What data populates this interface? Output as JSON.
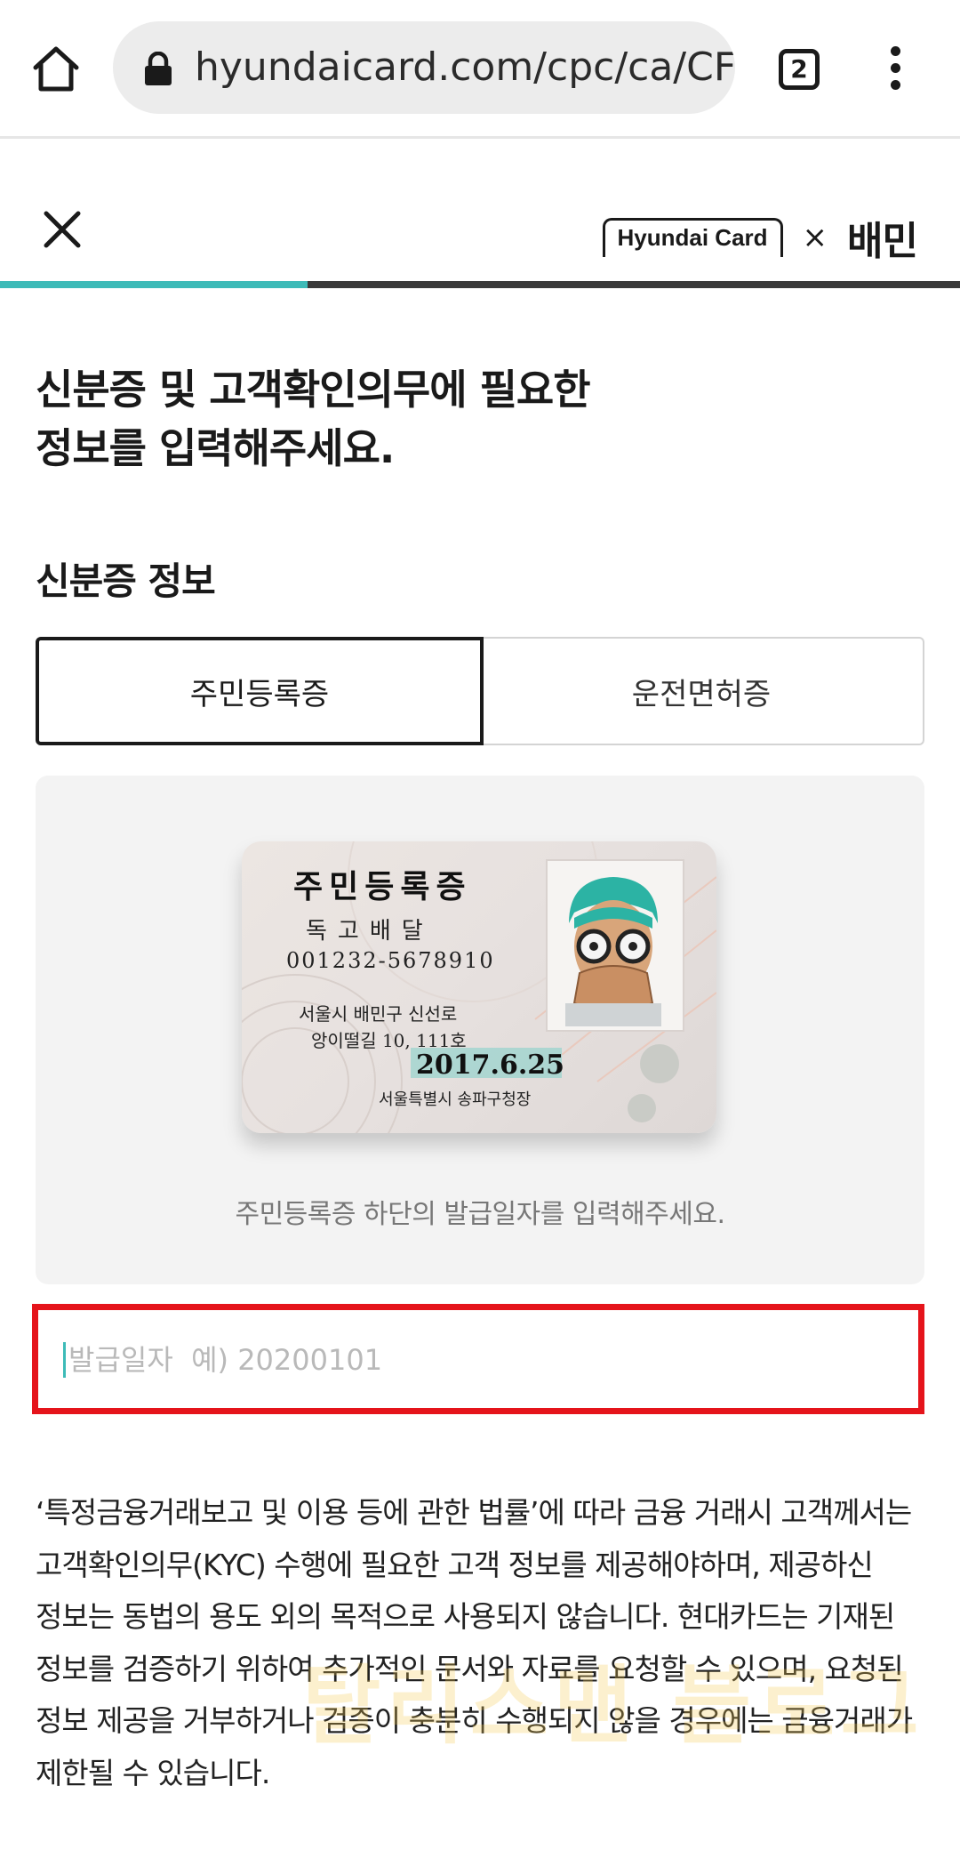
{
  "browser": {
    "url": "hyundaicard.com/cpc/ca/CF",
    "tab_count": "2",
    "icons": {
      "home": "home-icon",
      "lock": "lock-icon",
      "menu": "more-vert-icon"
    }
  },
  "header": {
    "close_icon": "close-icon",
    "brand_logo": "Hyundai Card",
    "brand_separator": "×",
    "partner_logo": "배민",
    "progress": 0.32,
    "progress_color": "#3dbbb8"
  },
  "page": {
    "title_line1": "신분증 및 고객확인의무에 필요한",
    "title_line2": "정보를 입력해주세요."
  },
  "id_section": {
    "title": "신분증 정보",
    "tabs": [
      {
        "label": "주민등록증",
        "selected": true
      },
      {
        "label": "운전면허증",
        "selected": false
      }
    ],
    "sample_card": {
      "title": "주민등록증",
      "name": "독고배달",
      "rrn": "001232-5678910",
      "address_line1": "서울시 배민구 신선로",
      "address_line2": "앙이떨길 10, 111호",
      "issue_date": "2017.6.25",
      "issuer": "서울특별시 송파구청장"
    },
    "guide_caption": "주민등록증 하단의 발급일자를 입력해주세요.",
    "issue_date_input": {
      "value": "",
      "placeholder": "발급일자  예) 20200101"
    }
  },
  "notice": {
    "text": "‘특정금융거래보고 및 이용 등에 관한 법률’에 따라 금융 거래시 고객께서는 고객확인의무(KYC) 수행에 필요한 고객 정보를 제공해야하며, 제공하신 정보는 동법의 용도 외의 목적으로 사용되지 않습니다. 현대카드는 기재된 정보를 검증하기 위하여 추가적인 문서와 자료를 요청할 수 있으며, 요청된 정보 제공을 거부하거나 검증이 충분히 수행되지 않을 경우에는 금융거래가 제한될 수 있습니다."
  },
  "colors": {
    "accent": "#3dbbb8",
    "highlight_border": "#e5141b"
  },
  "watermark": "탈리스맨 블로그"
}
